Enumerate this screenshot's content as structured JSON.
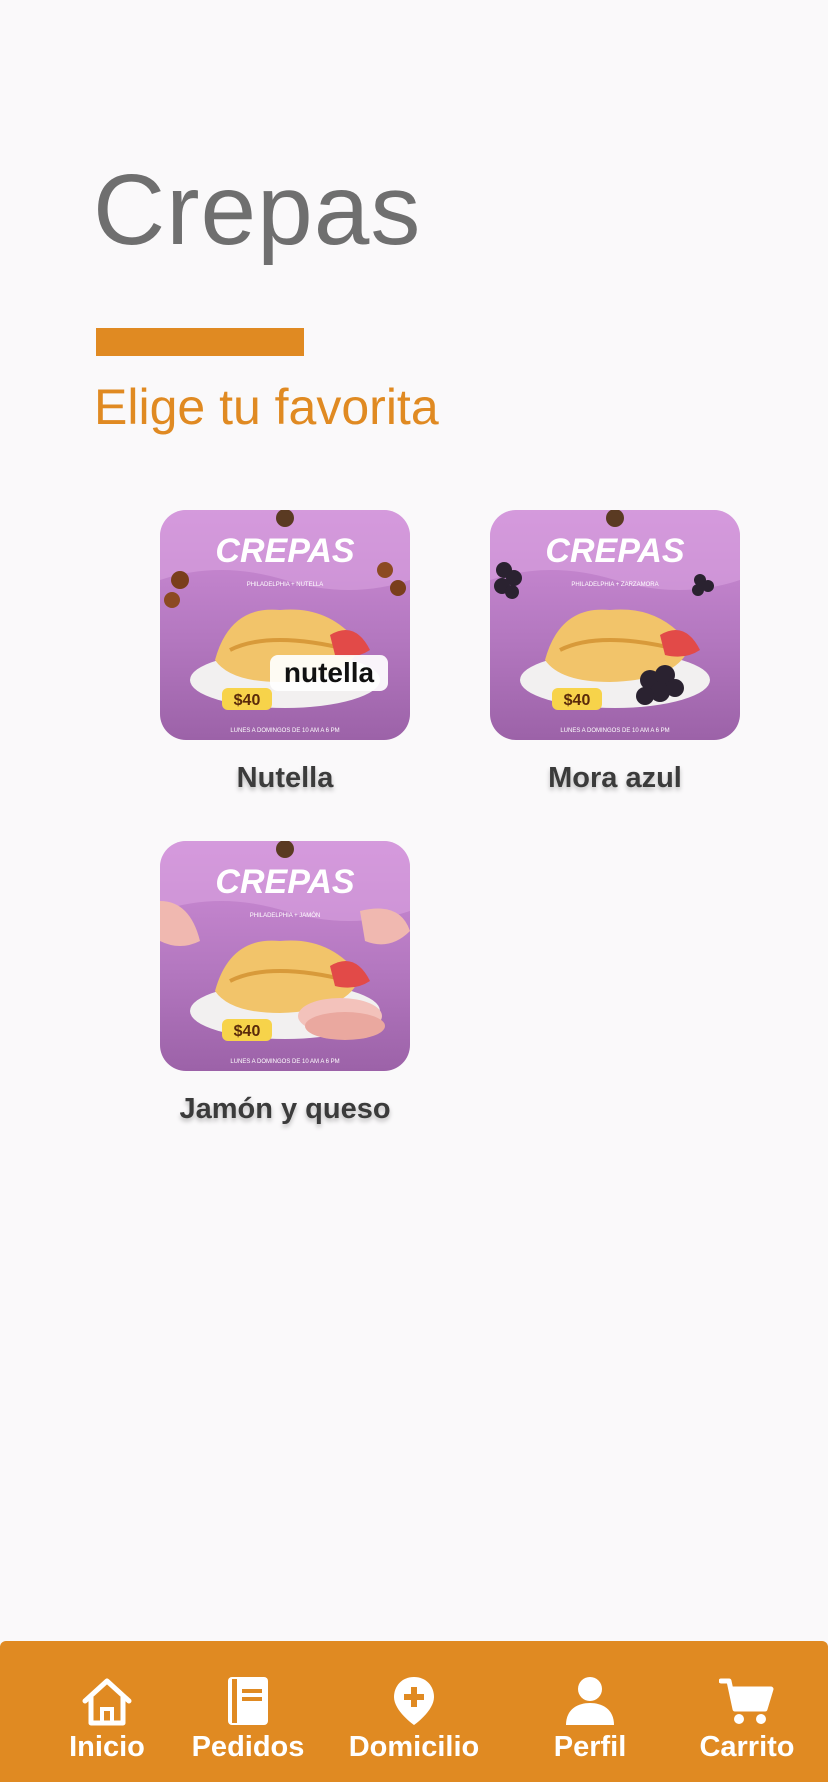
{
  "header": {
    "title": "Crepas",
    "subtitle": "Elige tu favorita"
  },
  "products": [
    {
      "name": "Nutella",
      "poster": {
        "brand": "CREPAS",
        "subtitle": "PHILADELPHIA + NUTELLA",
        "price": "$40",
        "footer": "LUNES A DOMINGOS DE 10 AM A 6 PM",
        "overlay": "nutella"
      }
    },
    {
      "name": "Mora azul",
      "poster": {
        "brand": "CREPAS",
        "subtitle": "PHILADELPHIA + ZARZAMORA",
        "price": "$40",
        "footer": "LUNES A DOMINGOS DE 10 AM A 6 PM",
        "overlay": ""
      }
    },
    {
      "name": "Jamón y queso",
      "poster": {
        "brand": "CREPAS",
        "subtitle": "PHILADELPHIA + JAMÓN",
        "price": "$40",
        "footer": "LUNES A DOMINGOS DE 10 AM A 6 PM",
        "overlay": ""
      }
    }
  ],
  "nav": {
    "items": [
      {
        "label": "Inicio",
        "icon": "home-icon"
      },
      {
        "label": "Pedidos",
        "icon": "book-icon"
      },
      {
        "label": "Domicilio",
        "icon": "map-pin-add-icon"
      },
      {
        "label": "Perfil",
        "icon": "person-icon"
      },
      {
        "label": "Carrito",
        "icon": "cart-icon"
      }
    ]
  },
  "colors": {
    "accent": "#e08a22",
    "title": "#6f6f6f",
    "background": "#faf9fa",
    "poster_purple": "#c388cf"
  }
}
